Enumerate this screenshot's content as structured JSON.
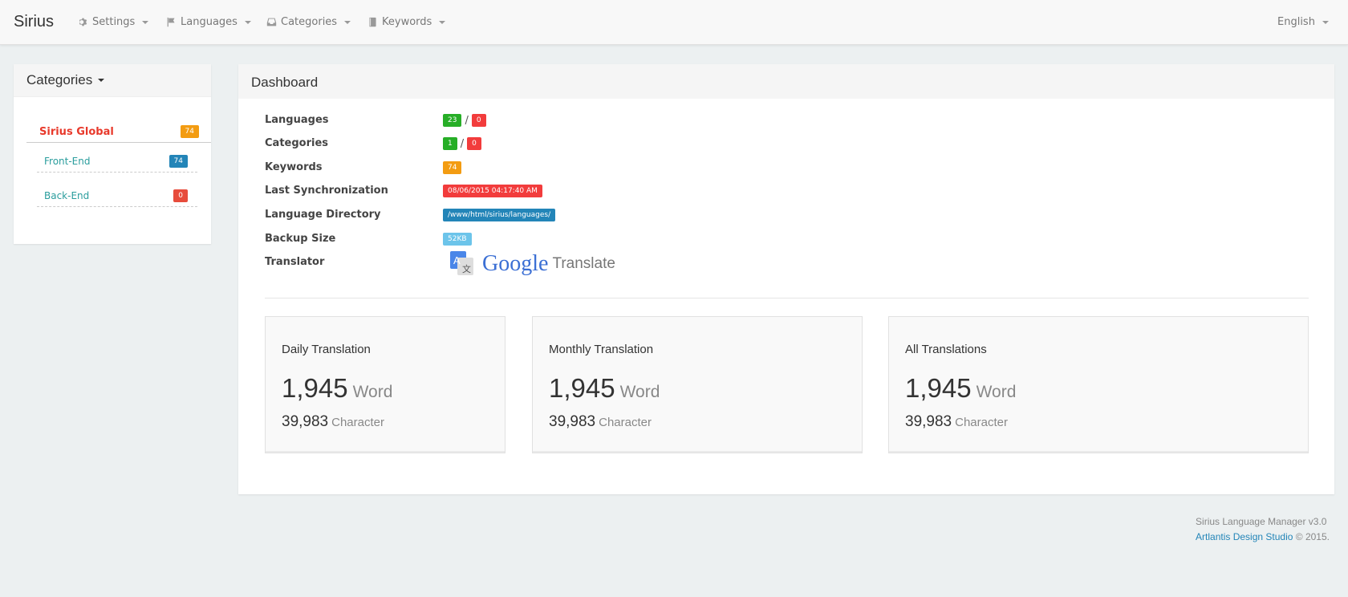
{
  "navbar": {
    "brand": "Sirius",
    "items": [
      {
        "label": "Settings",
        "icon": "gear-icon"
      },
      {
        "label": "Languages",
        "icon": "flag-icon"
      },
      {
        "label": "Categories",
        "icon": "inbox-icon"
      },
      {
        "label": "Keywords",
        "icon": "book-icon"
      }
    ],
    "language": "English"
  },
  "sidebar": {
    "title": "Categories",
    "items": [
      {
        "label": "Sirius Global",
        "count": "74",
        "color": "#f39c12"
      },
      {
        "label": "Front-End",
        "count": "74",
        "color": "#2385b8"
      },
      {
        "label": "Back-End",
        "count": "0",
        "color": "#e74c3c"
      }
    ]
  },
  "dashboard": {
    "title": "Dashboard",
    "languages": {
      "label": "Languages",
      "active": "23",
      "inactive": "0",
      "sep": "/"
    },
    "categories": {
      "label": "Categories",
      "active": "1",
      "inactive": "0",
      "sep": "/"
    },
    "keywords": {
      "label": "Keywords",
      "value": "74"
    },
    "last_sync": {
      "label": "Last Synchronization",
      "value": "08/06/2015 04:17:40 AM"
    },
    "lang_dir": {
      "label": "Language Directory",
      "value": "/www/html/sirius/languages/"
    },
    "backup": {
      "label": "Backup Size",
      "value": "52KB"
    },
    "translator": {
      "label": "Translator",
      "logo_text": "Google",
      "logo_suffix": "Translate"
    }
  },
  "stats": [
    {
      "title": "Daily Translation",
      "words": "1,945",
      "word_unit": "Word",
      "chars": "39,983",
      "char_unit": "Character"
    },
    {
      "title": "Monthly Translation",
      "words": "1,945",
      "word_unit": "Word",
      "chars": "39,983",
      "char_unit": "Character"
    },
    {
      "title": "All Translations",
      "words": "1,945",
      "word_unit": "Word",
      "chars": "39,983",
      "char_unit": "Character"
    }
  ],
  "footer": {
    "line1": "Sirius Language Manager v3.0",
    "link": "Artlantis Design Studio",
    "copyright": "© 2015."
  }
}
